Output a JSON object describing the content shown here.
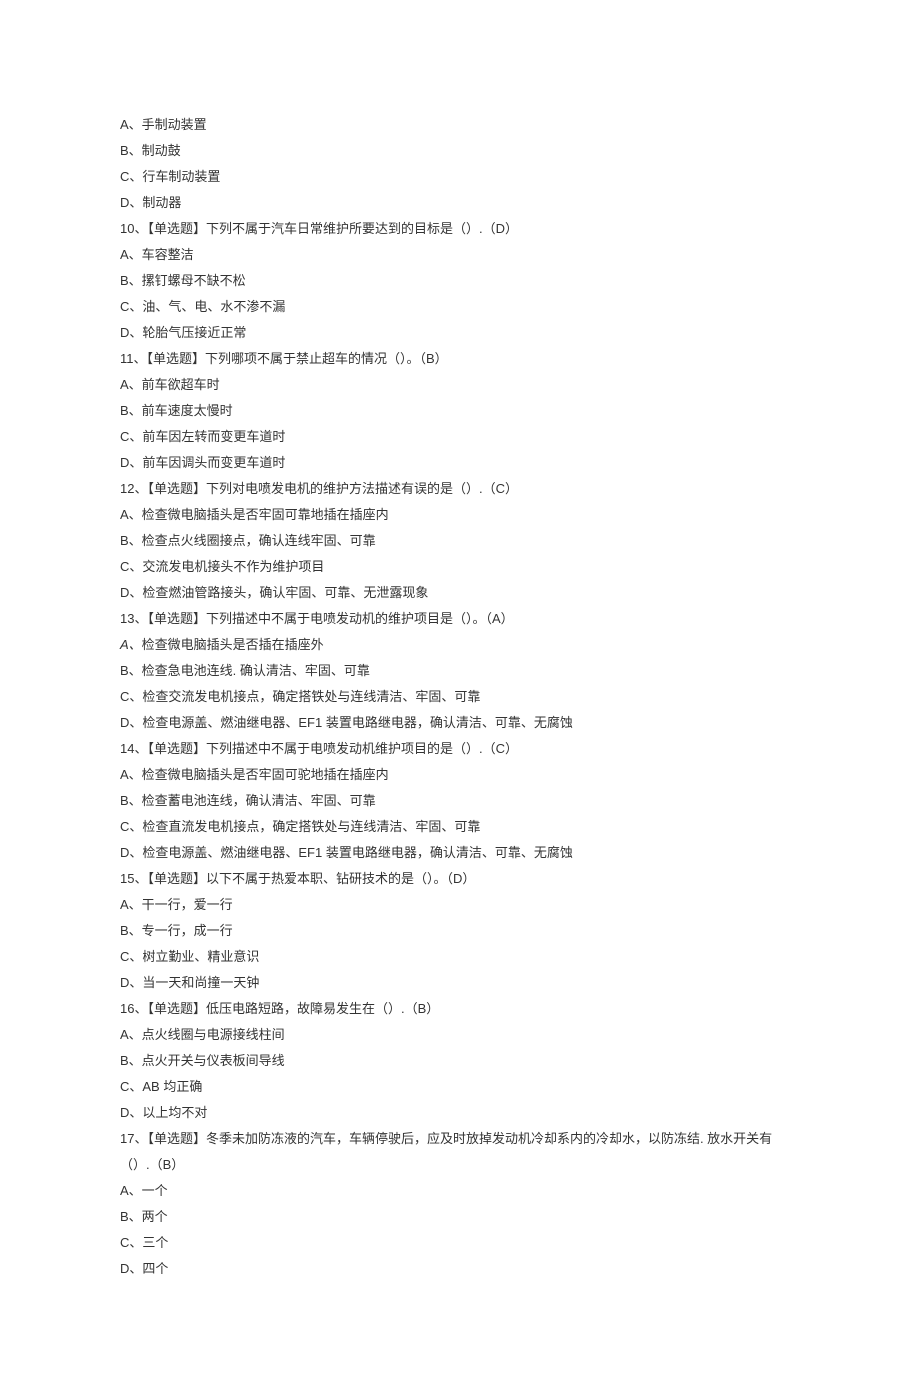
{
  "lines": [
    "A、手制动装置",
    "B、制动鼓",
    "C、行车制动装置",
    "D、制动器",
    "10、【单选题】下列不属于汽车日常维护所要达到的目标是（）.（D）",
    "A、车容整洁",
    "B、摞钉螺母不缺不松",
    "C、油、气、电、水不渗不漏",
    "D、轮胎气压接近正常",
    "11、【单选题】下列哪项不属于禁止超车的情况（）。（B）",
    "A、前车欲超车时",
    "B、前车速度太慢时",
    "C、前车因左转而变更车道时",
    "D、前车因调头而变更车道时",
    "12、【单选题】下列对电喷发电机的维护方法描述有误的是（）.（C）",
    "A、检查微电脑插头是否牢固可靠地插在插座内",
    "B、检查点火线圈接点，确认连线牢固、可靠",
    "C、交流发电机接头不作为维护项目",
    "D、检查燃油管路接头，确认牢固、可靠、无泄露现象",
    "13、【单选题】下列描述中不属于电喷发动机的维护项目是（）。（A）",
    "A、检查微电脑插头是否插在插座外",
    "B、检查急电池连线. 确认清洁、牢固、可靠",
    "C、检查交流发电机接点，确定搭铁处与连线清洁、牢固、可靠",
    "D、检查电源盖、燃油继电器、EF1 装置电路继电器，确认清洁、可靠、无腐蚀",
    "14、【单选题】下列描述中不属于电喷发动机维护项目的是（）.（C）",
    "A、检查微电脑插头是否牢固可驼地插在插座内",
    "B、检查蓄电池连线，确认清洁、牢固、可靠",
    "C、检查直流发电机接点，确定搭铁处与连线清洁、牢固、可靠",
    "D、检查电源盖、燃油继电器、EF1 装置电路继电器，确认清洁、可靠、无腐蚀",
    "15、【单选题】以下不属于热爱本职、钻研技术的是（）。（D）",
    "A、干一行，爱一行",
    "B、专一行，成一行",
    "C、树立勤业、精业意识",
    "D、当一天和尚撞一天钟",
    "16、【单选题】低压电路短路，故障易发生在（）.（B）",
    "A、点火线圈与电源接线柱间",
    "B、点火开关与仪表板间导线",
    "C、AB 均正确",
    "D、以上均不对",
    "17、【单选题】冬季未加防冻液的汽车，车辆停驶后，应及时放掉发动机冷却系内的冷却水，以防冻结. 放水开关有（）.（B）",
    "A、一个",
    "B、两个",
    "C、三个",
    "D、四个"
  ],
  "italic_index": 20
}
